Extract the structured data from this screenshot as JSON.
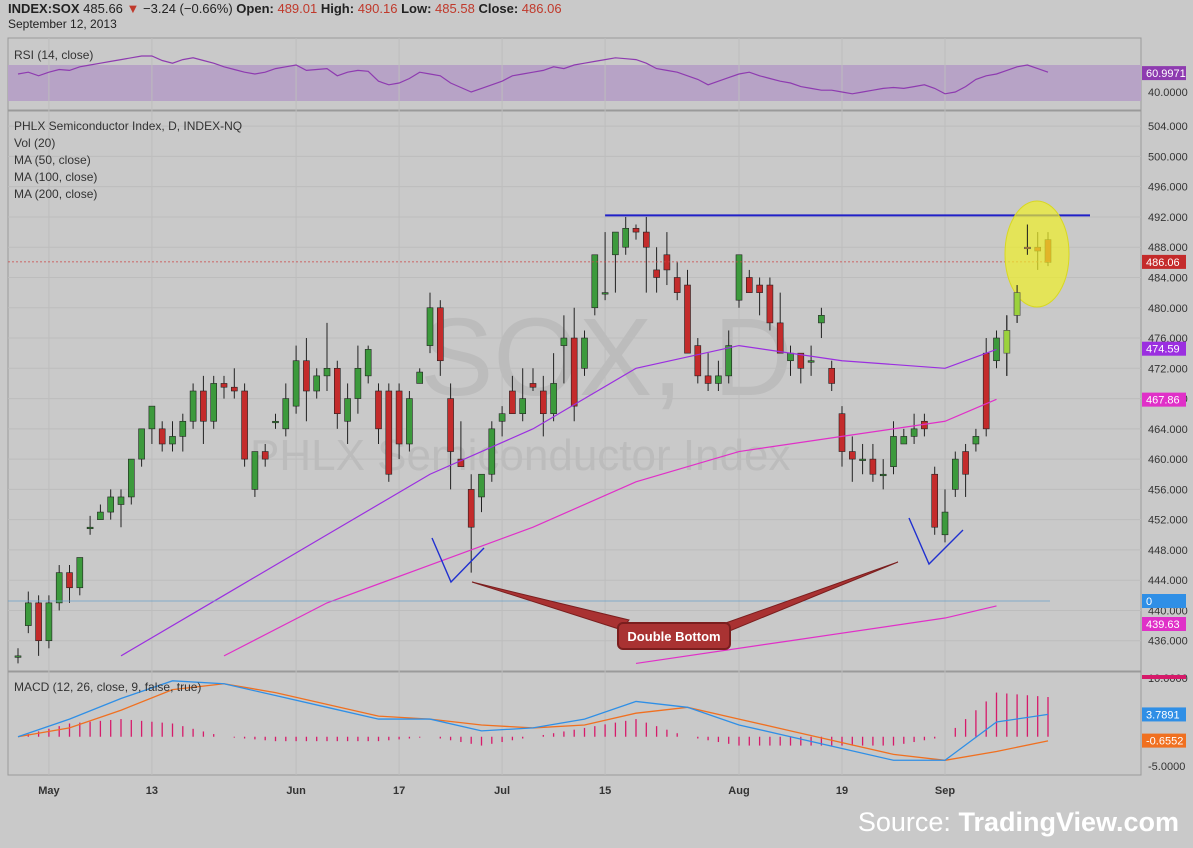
{
  "header": {
    "symbol": "INDEX:SOX",
    "last": "485.66",
    "change_arrow": "▼",
    "change": "−3.24 (−0.66%)",
    "open_label": "Open:",
    "open": "489.01",
    "high_label": "High:",
    "high": "490.16",
    "low_label": "Low:",
    "low": "485.58",
    "close_label": "Close:",
    "close": "486.06",
    "date": "September 12, 2013"
  },
  "panes": {
    "rsi_label": "RSI (14, close)",
    "price_legend": [
      "PHLX Semiconductor Index, D, INDEX-NQ",
      "Vol (20)",
      "MA (50, close)",
      "MA (100, close)",
      "MA (200, close)"
    ],
    "macd_label": "MACD (12, 26, close, 9, false, true)"
  },
  "watermark": {
    "symbol": "SOX, D",
    "name": "PHLX Semiconductor Index"
  },
  "annotation": {
    "double_bottom": "Double Bottom"
  },
  "source": {
    "prefix": "Source:",
    "brand": "TradingView.com"
  },
  "colors": {
    "up": "#3c9a3c",
    "down": "#c42b2b",
    "ma50": "#9b2fe0",
    "ma100": "#e030c8",
    "rsi": "#8e3bb0",
    "macd": "#2f8fe6",
    "signal": "#f07020",
    "hist": "#d61a6a",
    "resistance": "#2020c8"
  },
  "chart_data": [
    {
      "type": "candlestick",
      "title": "PHLX Semiconductor Index, D, INDEX-NQ",
      "ylim": [
        432,
        506
      ],
      "yticks": [
        436,
        440,
        444,
        448,
        452,
        456,
        460,
        464,
        468,
        472,
        476,
        480,
        484,
        488,
        492,
        496,
        500,
        504
      ],
      "xticks": [
        {
          "label": "May",
          "i": 3
        },
        {
          "label": "13",
          "i": 13
        },
        {
          "label": "Jun",
          "i": 27
        },
        {
          "label": "17",
          "i": 37
        },
        {
          "label": "Jul",
          "i": 47
        },
        {
          "label": "15",
          "i": 57
        },
        {
          "label": "Aug",
          "i": 70
        },
        {
          "label": "19",
          "i": 80
        },
        {
          "label": "Sep",
          "i": 90
        }
      ],
      "ohlc": [
        [
          434,
          435,
          433,
          434
        ],
        [
          438,
          442.5,
          437,
          441
        ],
        [
          441,
          442,
          434,
          436
        ],
        [
          436,
          442,
          435,
          441
        ],
        [
          441,
          446,
          440,
          445
        ],
        [
          445,
          446,
          441,
          443
        ],
        [
          443,
          447,
          442,
          447
        ],
        [
          451,
          452.5,
          450,
          451
        ],
        [
          452,
          454,
          452,
          453
        ],
        [
          453,
          456,
          452,
          455
        ],
        [
          454,
          456,
          451,
          455
        ],
        [
          455,
          460,
          454,
          460
        ],
        [
          460,
          464,
          459,
          464
        ],
        [
          464,
          467,
          462,
          467
        ],
        [
          464,
          465,
          461,
          462
        ],
        [
          462,
          465,
          461,
          463
        ],
        [
          463,
          466,
          461,
          465
        ],
        [
          465,
          470,
          464,
          469
        ],
        [
          469,
          471,
          462,
          465
        ],
        [
          465,
          471,
          464,
          470
        ],
        [
          470,
          471,
          468,
          469.5
        ],
        [
          469.5,
          472,
          468,
          469
        ],
        [
          469,
          470,
          459,
          460
        ],
        [
          456,
          461,
          455,
          461
        ],
        [
          461,
          462,
          459,
          460
        ],
        [
          465,
          466,
          464,
          465
        ],
        [
          464,
          470,
          463,
          468
        ],
        [
          467,
          475,
          466,
          473
        ],
        [
          473,
          476,
          465,
          469
        ],
        [
          469,
          472,
          468,
          471
        ],
        [
          471,
          478,
          469,
          472
        ],
        [
          472,
          473,
          464,
          466
        ],
        [
          465,
          470,
          462,
          468
        ],
        [
          468,
          475,
          466,
          472
        ],
        [
          471,
          475,
          470,
          474.5
        ],
        [
          469,
          470,
          462,
          464
        ],
        [
          469,
          470,
          457,
          458
        ],
        [
          469,
          470,
          460,
          462
        ],
        [
          462,
          469,
          461,
          468
        ],
        [
          470,
          472,
          470,
          471.5
        ],
        [
          475,
          482,
          474,
          480
        ],
        [
          480,
          481,
          471,
          473
        ],
        [
          468,
          470,
          456,
          461
        ],
        [
          460,
          465,
          459,
          459
        ],
        [
          456,
          458,
          445,
          451
        ],
        [
          455,
          458,
          453,
          458
        ],
        [
          458,
          465,
          457,
          464
        ],
        [
          465,
          467,
          463,
          466
        ],
        [
          469,
          471,
          466,
          466
        ],
        [
          466,
          472,
          465,
          468
        ],
        [
          470,
          472,
          469,
          469.5
        ],
        [
          469,
          471,
          463,
          466
        ],
        [
          466,
          474,
          465,
          470
        ],
        [
          475,
          479,
          470,
          476
        ],
        [
          476,
          480,
          465,
          467
        ],
        [
          472,
          477,
          471,
          476
        ],
        [
          480,
          485,
          479,
          487
        ],
        [
          482,
          490,
          481,
          482
        ],
        [
          487,
          489,
          482,
          490
        ],
        [
          488,
          492,
          487,
          490.5
        ],
        [
          490.5,
          491,
          489,
          490
        ],
        [
          490,
          492,
          482,
          488
        ],
        [
          485,
          488,
          482,
          484
        ],
        [
          487,
          490,
          483,
          485
        ],
        [
          484,
          486,
          481,
          482
        ],
        [
          483,
          485,
          474,
          474
        ],
        [
          475,
          476,
          470,
          471
        ],
        [
          471,
          474,
          469,
          470
        ],
        [
          470,
          473,
          469,
          471
        ],
        [
          471,
          477,
          470,
          475
        ],
        [
          481,
          487,
          480,
          487
        ],
        [
          484,
          485,
          482,
          482
        ],
        [
          483,
          484,
          479,
          482
        ],
        [
          483,
          484,
          477,
          478
        ],
        [
          478,
          482,
          474,
          474
        ],
        [
          473,
          475,
          471,
          474
        ],
        [
          474,
          474,
          470,
          472
        ],
        [
          473,
          475,
          471,
          473
        ],
        [
          478,
          480,
          476,
          479
        ],
        [
          472,
          473,
          469,
          470
        ],
        [
          466,
          467,
          459,
          461
        ],
        [
          461,
          463,
          457,
          460
        ],
        [
          460,
          462,
          458,
          460
        ],
        [
          460,
          462,
          457,
          458
        ],
        [
          458,
          460,
          456,
          458
        ],
        [
          459,
          465,
          458,
          463
        ],
        [
          462,
          464,
          462,
          463
        ],
        [
          463,
          466,
          462,
          464
        ],
        [
          465,
          466,
          463,
          464
        ],
        [
          458,
          459,
          450,
          451
        ],
        [
          450,
          456,
          449,
          453
        ],
        [
          456,
          461,
          455,
          460
        ],
        [
          461,
          462,
          455,
          458
        ],
        [
          462,
          464,
          461,
          463
        ],
        [
          474,
          476,
          463,
          464
        ],
        [
          473,
          477,
          472,
          476
        ],
        [
          477,
          479,
          471,
          474
        ],
        [
          479,
          483,
          478,
          482
        ],
        [
          488,
          491,
          487,
          488
        ],
        [
          488,
          490,
          485,
          487.5
        ],
        [
          489,
          490,
          485.5,
          486
        ]
      ],
      "ma50": [
        [
          10,
          434
        ],
        [
          20,
          442
        ],
        [
          30,
          450
        ],
        [
          40,
          458
        ],
        [
          50,
          464
        ],
        [
          60,
          472
        ],
        [
          70,
          475
        ],
        [
          80,
          473
        ],
        [
          90,
          472
        ],
        [
          95,
          474.5
        ]
      ],
      "ma100": [
        [
          20,
          434
        ],
        [
          30,
          441
        ],
        [
          40,
          446
        ],
        [
          50,
          451
        ],
        [
          60,
          457
        ],
        [
          70,
          461
        ],
        [
          80,
          463
        ],
        [
          90,
          465
        ],
        [
          95,
          467.9
        ]
      ],
      "ma200": [
        [
          60,
          433
        ],
        [
          75,
          436
        ],
        [
          90,
          439
        ],
        [
          95,
          440.6
        ]
      ],
      "resistance_y": 492.2,
      "current": 486.06,
      "labels": {
        "current": "486.06",
        "ma50": "474.59",
        "ma100": "467.86",
        "vol": "0",
        "ma200": "439.63"
      }
    },
    {
      "type": "line",
      "title": "RSI (14, close)",
      "ylim": [
        20,
        100
      ],
      "yticks": [
        {
          "label": "40.0000",
          "v": 40
        }
      ],
      "values": [
        60,
        62,
        58,
        62,
        65,
        64,
        68,
        70,
        72,
        74,
        76,
        78,
        80,
        80,
        75,
        72,
        76,
        78,
        75,
        72,
        68,
        65,
        62,
        60,
        62,
        66,
        68,
        70,
        64,
        65,
        66,
        58,
        62,
        64,
        63,
        52,
        48,
        50,
        55,
        62,
        60,
        58,
        50,
        45,
        40,
        44,
        48,
        52,
        58,
        60,
        62,
        64,
        68,
        66,
        70,
        72,
        74,
        76,
        78,
        77,
        76,
        72,
        66,
        64,
        62,
        58,
        54,
        48,
        52,
        56,
        60,
        62,
        58,
        55,
        52,
        50,
        46,
        44,
        42,
        42,
        40,
        38,
        40,
        42,
        44,
        45,
        44,
        46,
        48,
        44,
        38,
        40,
        46,
        54,
        58,
        60,
        64,
        68,
        70,
        66,
        62
      ],
      "current": 60.9971,
      "labels": {
        "current": "60.9971"
      }
    },
    {
      "type": "line",
      "title": "MACD (12, 26, close, 9, false, true)",
      "ylim": [
        -6.5,
        11
      ],
      "yticks": [
        {
          "label": "10.0000",
          "v": 10
        },
        {
          "label": "-5.0000",
          "v": -5
        }
      ],
      "macd": [
        [
          0,
          0
        ],
        [
          5,
          3
        ],
        [
          10,
          6.5
        ],
        [
          15,
          9.5
        ],
        [
          20,
          9
        ],
        [
          25,
          7
        ],
        [
          30,
          5
        ],
        [
          35,
          3
        ],
        [
          40,
          3
        ],
        [
          45,
          1
        ],
        [
          50,
          1.5
        ],
        [
          55,
          3
        ],
        [
          60,
          6
        ],
        [
          65,
          5
        ],
        [
          70,
          2
        ],
        [
          75,
          0
        ],
        [
          80,
          -2
        ],
        [
          85,
          -4
        ],
        [
          90,
          -4
        ],
        [
          95,
          2.5
        ],
        [
          100,
          3.8
        ]
      ],
      "signal": [
        [
          0,
          0
        ],
        [
          5,
          1.5
        ],
        [
          10,
          4.5
        ],
        [
          15,
          8
        ],
        [
          20,
          9
        ],
        [
          25,
          7.5
        ],
        [
          30,
          5.5
        ],
        [
          35,
          3.5
        ],
        [
          40,
          3
        ],
        [
          45,
          2
        ],
        [
          50,
          1.5
        ],
        [
          55,
          2
        ],
        [
          60,
          4
        ],
        [
          65,
          5
        ],
        [
          70,
          3
        ],
        [
          75,
          1
        ],
        [
          80,
          -1
        ],
        [
          85,
          -3
        ],
        [
          90,
          -4
        ],
        [
          95,
          -2.5
        ],
        [
          100,
          -0.7
        ]
      ],
      "labels": {
        "macd": "3.7891",
        "signal": "-0.6552"
      }
    }
  ]
}
